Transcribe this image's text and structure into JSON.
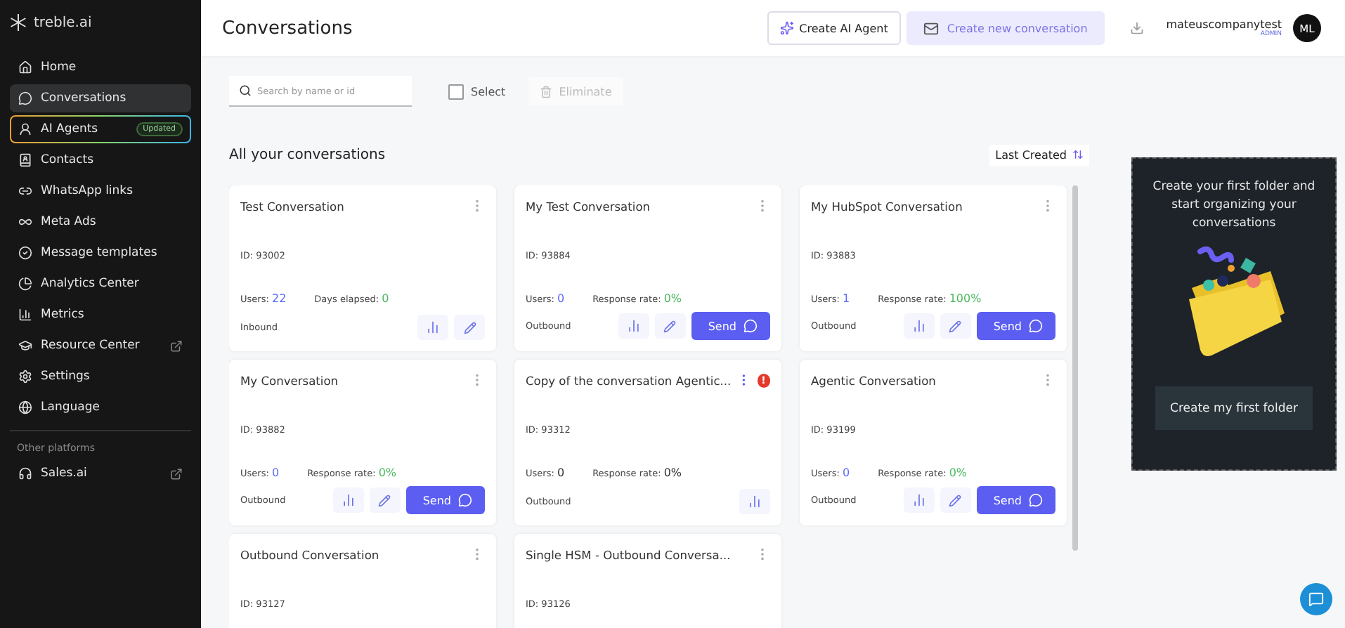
{
  "sidebar": {
    "brand": "treble.ai",
    "items": [
      {
        "label": "Home",
        "selected": false
      },
      {
        "label": "Conversations",
        "selected": true
      },
      {
        "label": "AI Agents",
        "selected": false,
        "highlighted": true,
        "badge": "Updated"
      },
      {
        "label": "Contacts",
        "selected": false
      },
      {
        "label": "WhatsApp links",
        "selected": false
      },
      {
        "label": "Meta Ads",
        "selected": false
      },
      {
        "label": "Message templates",
        "selected": false
      },
      {
        "label": "Analytics Center",
        "selected": false
      },
      {
        "label": "Metrics",
        "selected": false
      },
      {
        "label": "Resource Center",
        "selected": false,
        "external": true
      },
      {
        "label": "Settings",
        "selected": false
      },
      {
        "label": "Language",
        "selected": false
      }
    ],
    "section_label": "Other platforms",
    "other_items": [
      {
        "label": "Sales.ai",
        "selected": false,
        "external": true
      }
    ]
  },
  "header": {
    "title": "Conversations",
    "create_agent_button": "Create AI Agent",
    "create_conversation_button": "Create new conversation",
    "user_name": "mateuscompanytest",
    "user_role": "ADMIN",
    "avatar_initials": "ML"
  },
  "toolbar": {
    "search_placeholder": "Search by name or id",
    "select_label": "Select",
    "select_checked": false,
    "eliminate_label": "Eliminate",
    "eliminate_disabled": true
  },
  "list": {
    "heading": "All your conversations",
    "sort_label": "Last Created"
  },
  "cards": [
    {
      "title": "Test Conversation",
      "id": "ID: 93002",
      "users_label": "Users:",
      "users": "22",
      "metric_label": "Days elapsed:",
      "metric": "0",
      "muted": false,
      "direction": "Inbound",
      "actions": [
        {
          "kind": "stats"
        },
        {
          "kind": "edit"
        }
      ],
      "alert": false
    },
    {
      "title": "My Test Conversation",
      "id": "ID: 93884",
      "users_label": "Users:",
      "users": "0",
      "metric_label": "Response rate:",
      "metric": "0%",
      "muted": false,
      "direction": "Outbound",
      "actions": [
        {
          "kind": "stats"
        },
        {
          "kind": "edit"
        },
        {
          "kind": "send",
          "label": "Send"
        }
      ],
      "alert": false
    },
    {
      "title": "My HubSpot Conversation",
      "id": "ID: 93883",
      "users_label": "Users:",
      "users": "1",
      "metric_label": "Response rate:",
      "metric": "100%",
      "muted": false,
      "direction": "Outbound",
      "actions": [
        {
          "kind": "stats"
        },
        {
          "kind": "edit"
        },
        {
          "kind": "send",
          "label": "Send"
        }
      ],
      "alert": false
    },
    {
      "title": "My Conversation",
      "id": "ID: 93882",
      "users_label": "Users:",
      "users": "0",
      "metric_label": "Response rate:",
      "metric": "0%",
      "muted": false,
      "direction": "Outbound",
      "actions": [
        {
          "kind": "stats"
        },
        {
          "kind": "edit"
        },
        {
          "kind": "send",
          "label": "Send"
        }
      ],
      "alert": false
    },
    {
      "title": "Copy of the conversation Agentic...",
      "id": "ID: 93312",
      "users_label": "Users:",
      "users": "0",
      "metric_label": "Response rate:",
      "metric": "0%",
      "muted": true,
      "direction": "Outbound",
      "actions": [
        {
          "kind": "stats"
        }
      ],
      "alert": true,
      "alert_mark": "!"
    },
    {
      "title": "Agentic Conversation",
      "id": "ID: 93199",
      "users_label": "Users:",
      "users": "0",
      "metric_label": "Response rate:",
      "metric": "0%",
      "muted": false,
      "direction": "Outbound",
      "actions": [
        {
          "kind": "stats"
        },
        {
          "kind": "edit"
        },
        {
          "kind": "send",
          "label": "Send"
        }
      ],
      "alert": false
    },
    {
      "title": "Outbound Conversation",
      "id": "ID: 93127",
      "alert": false
    },
    {
      "title": "Single HSM - Outbound Conversa...",
      "id": "ID: 93126",
      "alert": false
    }
  ],
  "folder_panel": {
    "text": "Create your first folder and start organizing your conversations",
    "button": "Create my first folder"
  }
}
